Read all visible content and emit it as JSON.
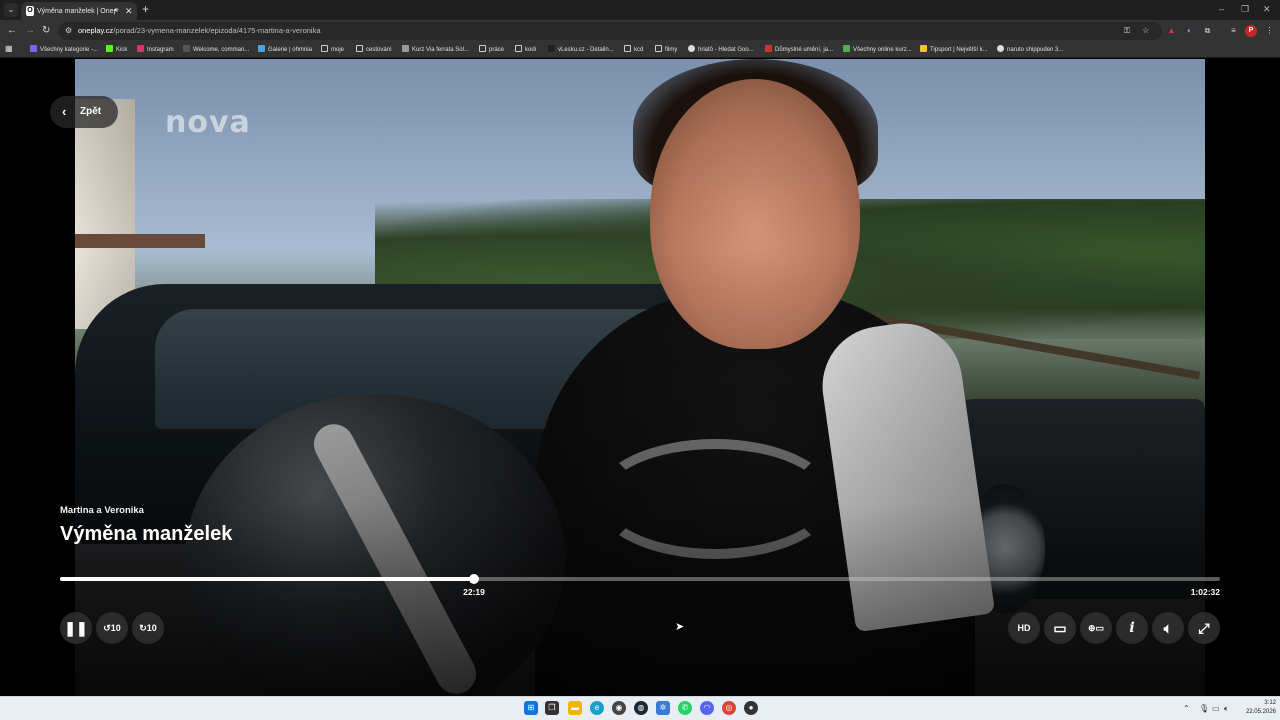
{
  "browser": {
    "tab": {
      "title": "Výměna manželek | Oneplay",
      "favicon": "oneplay-logo"
    },
    "url_host": "oneplay.cz",
    "url_path": "/porad/23-vymena-manzelek/epizoda/4175-martina-a-veronika",
    "new_tab_label": "+",
    "close_label": "✕",
    "bookmarks": [
      "Všechny kategorie -...",
      "Kick",
      "Instagram",
      "Welcome, comman...",
      "Galerie | ohmnia",
      "moje",
      "cestování",
      "Kurz Via ferrata Sol...",
      "práce",
      "kodi",
      "vLesku.cz - Detailn...",
      "kcd",
      "filmy",
      "hriatô - Hledat Goo...",
      "Důmyslné umění, ja...",
      "Všechny online kurz...",
      "Tipsport | Největší k...",
      "naruto shippuden 3..."
    ],
    "profile_initial": "P"
  },
  "player": {
    "back_label": "Zpět",
    "channel_logo": "nova",
    "episode_name": "Martina a Veronika",
    "show_title": "Výměna manželek",
    "current_time": "22:19",
    "total_time": "1:02:32",
    "progress_fraction": 0.357,
    "controls_left": [
      "pause-icon",
      "rewind-10-icon",
      "forward-10-icon"
    ],
    "controls_right": [
      "hd-icon",
      "subtitles-icon",
      "add-to-list-icon",
      "info-icon",
      "volume-icon",
      "fullscreen-icon"
    ],
    "hd_label": "HD",
    "info_label": "i"
  },
  "taskbar": {
    "time": "3:12",
    "date": "22.05.2026"
  }
}
